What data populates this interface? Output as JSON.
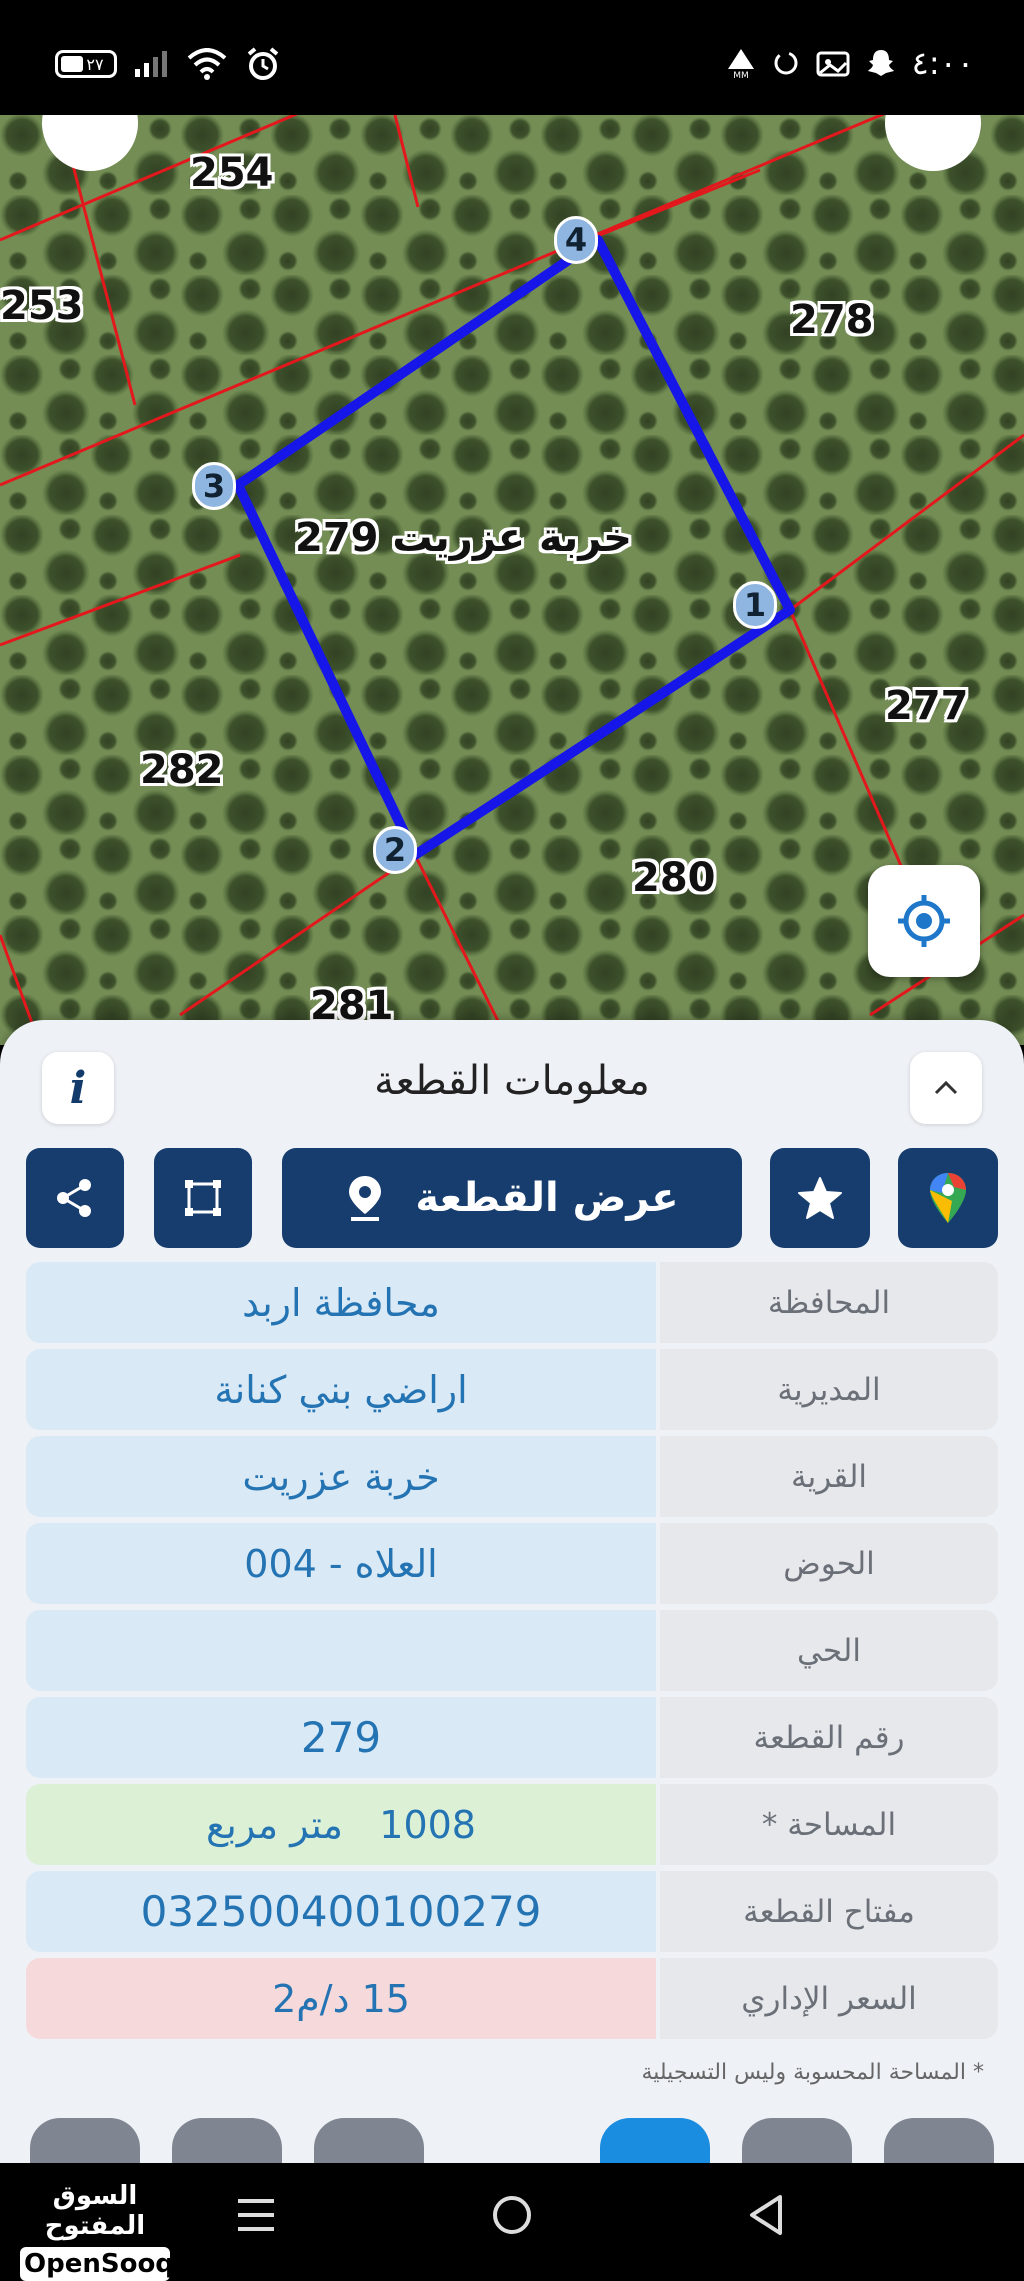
{
  "status_bar": {
    "time": "٤:٠٠",
    "battery": "٢٧",
    "left_icons": [
      "battery-icon",
      "signal-icon",
      "wifi-icon",
      "alarm-icon"
    ],
    "right_icons": [
      "data-icon",
      "sync-icon",
      "gallery-icon",
      "snapchat-icon"
    ]
  },
  "map": {
    "parcel_name": "خربة عزريت 279",
    "neighbors": [
      "254",
      "253",
      "278",
      "277",
      "282",
      "280",
      "281"
    ],
    "vertices": [
      "1",
      "2",
      "3",
      "4"
    ],
    "colors": {
      "boundary": "#1616e8",
      "lines": "#e3181d"
    }
  },
  "panel": {
    "title": "معلومات القطعة",
    "actions": {
      "view_parcel": "عرض القطعة"
    },
    "rows": [
      {
        "label": "المحافظة",
        "value": "محافظة اربد",
        "style": "normal"
      },
      {
        "label": "المديرية",
        "value": "اراضي بني كنانة",
        "style": "normal"
      },
      {
        "label": "القرية",
        "value": "خربة عزريت",
        "style": "normal"
      },
      {
        "label": "الحوض",
        "value": "العلاه - 004",
        "style": "normal"
      },
      {
        "label": "الحي",
        "value": "",
        "style": "normal"
      },
      {
        "label": "رقم القطعة",
        "value": "279",
        "style": "big"
      },
      {
        "label": "المساحة *",
        "value": "1008   متر مربع",
        "style": "green"
      },
      {
        "label": "مفتاح القطعة",
        "value": "032500400100279",
        "style": "big"
      },
      {
        "label": "السعر الإداري",
        "value": "15 د/م2",
        "style": "pink"
      }
    ],
    "footnote": "* المساحة المحسوبة وليس التسجيلية"
  },
  "nav": {
    "brand_ar": "السوق المفتوح",
    "brand_en": "OpenSooq"
  }
}
